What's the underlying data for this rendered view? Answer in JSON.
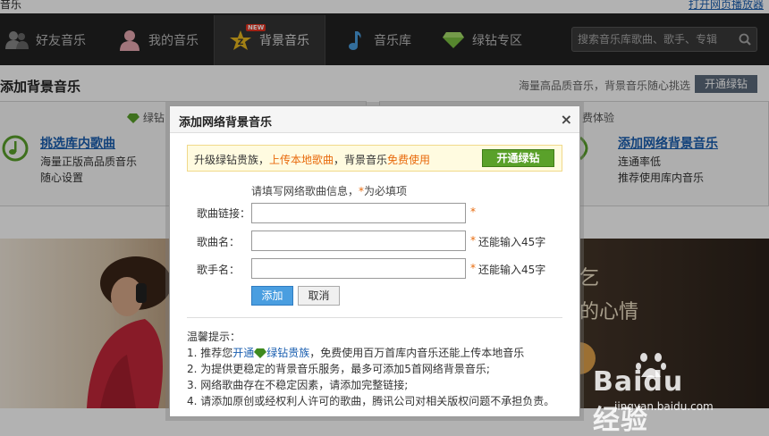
{
  "top": {
    "app_title": "音乐",
    "webplayer_link": "打开网页播放器"
  },
  "nav": {
    "items": [
      {
        "label": "好友音乐",
        "icon": "friends-icon"
      },
      {
        "label": "我的音乐",
        "icon": "user-icon"
      },
      {
        "label": "背景音乐",
        "icon": "crown-icon",
        "badge": "NEW",
        "active": true
      },
      {
        "label": "音乐库",
        "icon": "music-note-icon"
      },
      {
        "label": "绿钻专区",
        "icon": "green-diamond-icon"
      }
    ],
    "search_placeholder": "搜索音乐库歌曲、歌手、专辑",
    "search_icon": "search-icon"
  },
  "page": {
    "section_title": "添加背景音乐",
    "promo_text": "海量高品质音乐，背景音乐随心挑选",
    "open_green_button": "开通绿钻",
    "left_card": {
      "head": "绿钻",
      "title": "挑选库内歌曲",
      "line1": "海量正版高品质音乐",
      "line2": "随心设置"
    },
    "right_card": {
      "head": "费体验",
      "title": "添加网络背景音乐",
      "line1": "连通率低",
      "line2": "推荐使用库内音乐"
    },
    "banner_fragment": "乞",
    "banner_slogan": "的心情"
  },
  "dialog": {
    "title": "添加网络背景音乐",
    "close": "×",
    "upsell": {
      "pre": "升级绿钻贵族，",
      "highlight1": "上传本地歌曲",
      "mid": "，背景音乐",
      "highlight2": "免费使用",
      "button": "开通绿钻"
    },
    "instruction": "请填写网络歌曲信息，",
    "required_mark": "*",
    "required_suffix": "为必填项",
    "fields": [
      {
        "label": "歌曲链接：",
        "value": "",
        "star": "*",
        "hint": ""
      },
      {
        "label": "歌曲名：",
        "value": "",
        "star": "*",
        "hint": "还能输入45字"
      },
      {
        "label": "歌手名：",
        "value": "",
        "star": "*",
        "hint": "还能输入45字"
      }
    ],
    "add_button": "添加",
    "cancel_button": "取消",
    "tips_title": "温馨提示：",
    "tips": {
      "t1_pre": "1. 推荐您",
      "t1_link1": "开通",
      "t1_link2": "绿钻贵族",
      "t1_post": "，免费使用百万首库内音乐还能上传本地音乐",
      "t2": "2. 为提供更稳定的背景音乐服务，最多可添加5首网络背景音乐;",
      "t3": "3. 网络歌曲存在不稳定因素，请添加完整链接;",
      "t4": "4. 请添加原创或经权利人许可的歌曲，腾讯公司对相关版权问题不承担负责。"
    }
  },
  "watermark": {
    "brand": "Baidu经验",
    "url": "jingyan.baidu.com"
  },
  "colors": {
    "accent_green": "#5aa12a",
    "link_blue": "#1b5fb0",
    "highlight_orange": "#e86a0c",
    "nav_bg": "#222222"
  }
}
